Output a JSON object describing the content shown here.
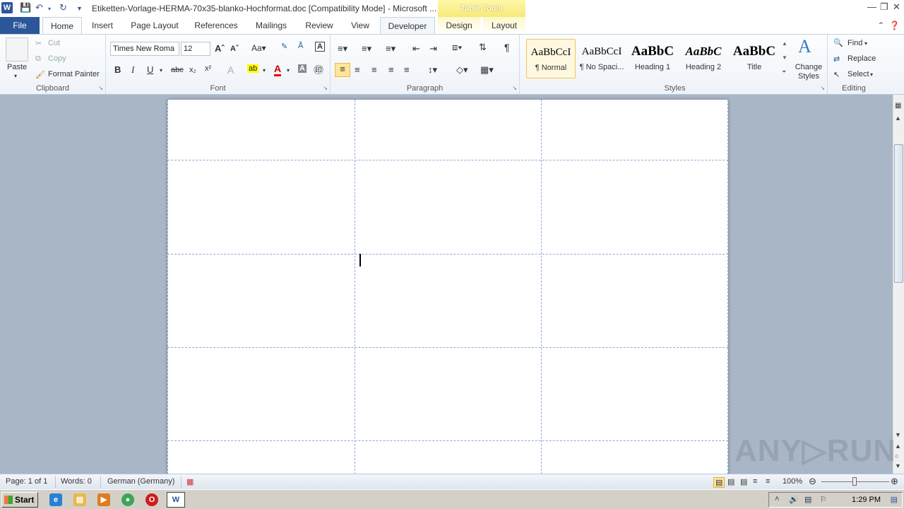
{
  "window": {
    "title": "Etiketten-Vorlage-HERMA-70x35-blanko-Hochformat.doc [Compatibility Mode] - Microsoft ...",
    "contextual_tab_group": "Table Tools",
    "app_icon_letter": "W"
  },
  "tabs": [
    "File",
    "Home",
    "Insert",
    "Page Layout",
    "References",
    "Mailings",
    "Review",
    "View",
    "Developer",
    "Design",
    "Layout"
  ],
  "ribbon": {
    "clipboard": {
      "paste": "Paste",
      "cut": "Cut",
      "copy": "Copy",
      "format_painter": "Format Painter",
      "label": "Clipboard"
    },
    "font": {
      "name": "Times New Roma",
      "size": "12",
      "label": "Font",
      "bold": "B",
      "italic": "I",
      "underline": "U"
    },
    "paragraph": {
      "label": "Paragraph"
    },
    "styles": {
      "items": [
        {
          "sample": "AaBbCcI",
          "name": "¶ Normal"
        },
        {
          "sample": "AaBbCcI",
          "name": "¶ No Spaci..."
        },
        {
          "sample": "AaBbC",
          "name": "Heading 1"
        },
        {
          "sample": "AaBbC",
          "name": "Heading 2"
        },
        {
          "sample": "AaBbC",
          "name": "Title"
        }
      ],
      "change_styles": "Change Styles",
      "label": "Styles"
    },
    "editing": {
      "find": "Find",
      "replace": "Replace",
      "select": "Select",
      "label": "Editing"
    }
  },
  "statusbar": {
    "page": "Page: 1 of 1",
    "words": "Words: 0",
    "language": "German (Germany)",
    "zoom": "100%"
  },
  "taskbar": {
    "start": "Start",
    "clock": "1:29 PM"
  },
  "watermark": "ANY▷RUN"
}
